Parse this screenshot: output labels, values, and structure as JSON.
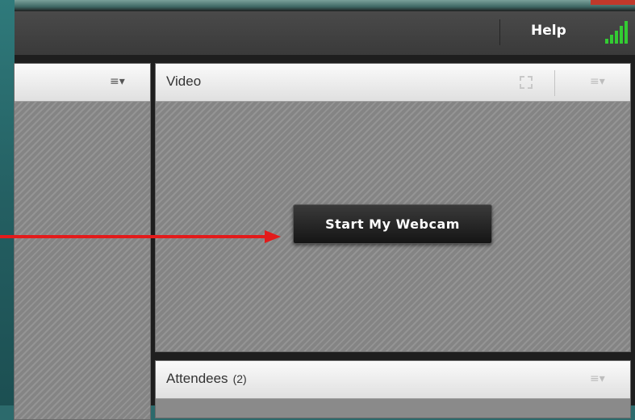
{
  "header": {
    "help_label": "Help",
    "signal_icon": "connection-signal-icon",
    "accent_color": "#33cc33"
  },
  "left_pod": {
    "menu_icon": "pod-menu-icon"
  },
  "video_pod": {
    "title": "Video",
    "fullscreen_icon": "fullscreen-icon",
    "menu_icon": "pod-menu-icon",
    "button_label": "Start My Webcam"
  },
  "attendees_pod": {
    "title": "Attendees",
    "count": "(2)",
    "menu_icon": "pod-menu-icon"
  },
  "annotation": {
    "arrow_color": "#e31b1b"
  },
  "menu_glyph": "≡▾"
}
